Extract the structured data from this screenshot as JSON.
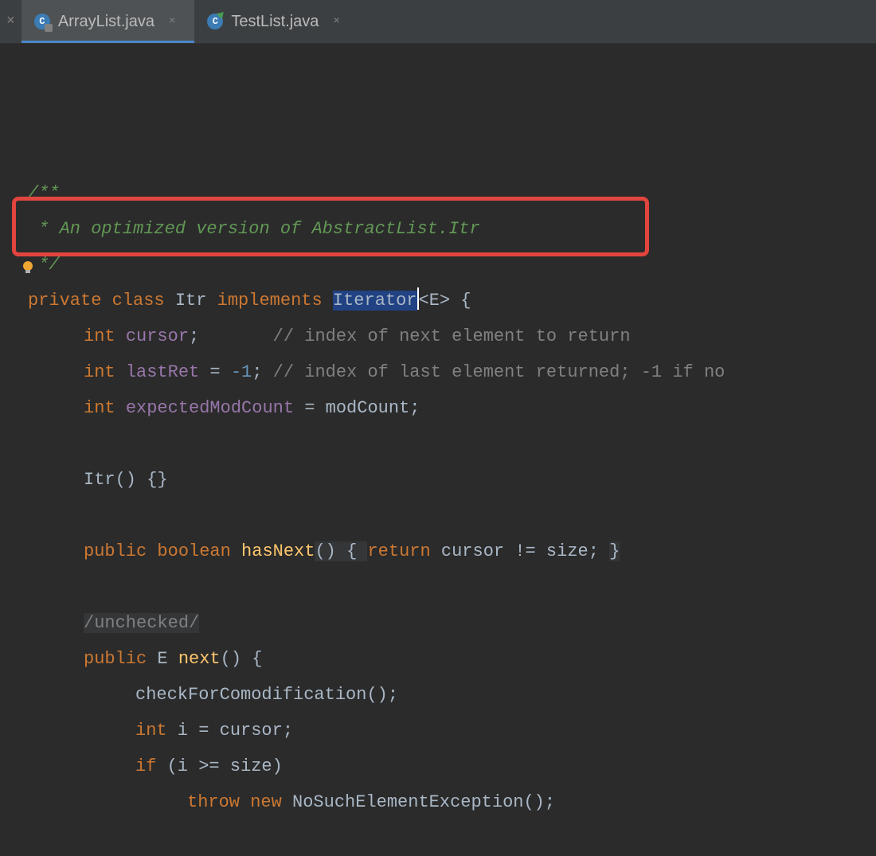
{
  "tabs": {
    "tab0_close": "×",
    "tab1_label": "ArrayList.java",
    "tab1_close": "×",
    "tab2_label": "TestList.java",
    "tab2_close": "×"
  },
  "code": {
    "doc1": "/**",
    "doc2": " * An optimized version of AbstractList.Itr",
    "doc3": " */",
    "kw_private": "private",
    "kw_class": "class",
    "cls_itr": "Itr",
    "kw_implements": "implements",
    "cls_iterator": "Iterator",
    "generic_e": "<E>",
    "brace_open": " {",
    "kw_int1": "int",
    "id_cursor": "cursor",
    "semi1": ";       ",
    "cmt1": "// index of next element to return",
    "kw_int2": "int",
    "id_lastret": "lastRet",
    "eq_neg1": " = ",
    "num_neg1": "-1",
    "semi2": "; ",
    "cmt2": "// index of last element returned; -1 if no",
    "kw_int3": "int",
    "id_expmod": "expectedModCount",
    "eq_mod": " = modCount;",
    "ctor": "Itr() {}",
    "kw_public1": "public",
    "kw_boolean": "boolean",
    "m_hasnext": "hasNext",
    "hasnext_body1": "() { ",
    "kw_return1": "return",
    "hasnext_body2": " cursor != size; ",
    "hasnext_close": "}",
    "annot": "/unchecked/",
    "kw_public2": "public",
    "type_e": "E",
    "m_next": "next",
    "next_sig": "() {",
    "call_check": "checkForComodification();",
    "kw_int4": "int",
    "assign_i": " i = cursor;",
    "kw_if": "if",
    "cond": " (i >= size)",
    "kw_throw": "throw",
    "kw_new": "new",
    "exc": "NoSuchElementException",
    "exc_tail": "();"
  }
}
